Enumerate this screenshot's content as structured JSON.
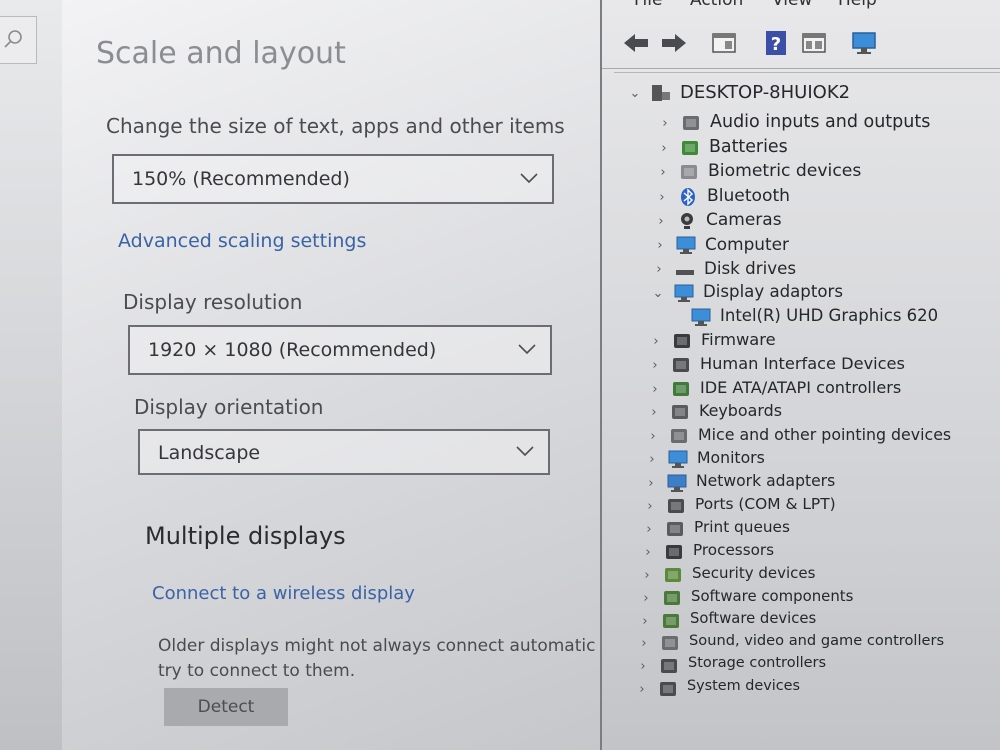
{
  "settings": {
    "title": "Scale and layout",
    "scale_label": "Change the size of text, apps and other items",
    "scale_value": "150% (Recommended)",
    "advanced_link": "Advanced scaling settings",
    "resolution_label": "Display resolution",
    "resolution_value": "1920 × 1080 (Recommended)",
    "orientation_label": "Display orientation",
    "orientation_value": "Landscape",
    "multiple_heading": "Multiple displays",
    "wireless_link": "Connect to a wireless display",
    "older_line1": "Older displays might not always connect automatic",
    "older_line2": "try to connect to them.",
    "detect_button": "Detect"
  },
  "device_manager": {
    "menu": [
      "File",
      "Action",
      "View",
      "Help"
    ],
    "toolbar_icons": [
      "back-arrow-icon",
      "forward-arrow-icon",
      "properties-icon",
      "help-icon",
      "view-icon",
      "monitor-icon"
    ],
    "root": "DESKTOP-8HUIOK2",
    "items": [
      {
        "label": "Audio inputs and outputs",
        "icon": "speaker-icon",
        "expanded": false
      },
      {
        "label": "Batteries",
        "icon": "battery-icon",
        "expanded": false
      },
      {
        "label": "Biometric devices",
        "icon": "fingerprint-icon",
        "expanded": false
      },
      {
        "label": "Bluetooth",
        "icon": "bluetooth-icon",
        "expanded": false
      },
      {
        "label": "Cameras",
        "icon": "camera-icon",
        "expanded": false
      },
      {
        "label": "Computer",
        "icon": "computer-icon",
        "expanded": false
      },
      {
        "label": "Disk drives",
        "icon": "disk-icon",
        "expanded": false
      },
      {
        "label": "Display adaptors",
        "icon": "display-adapter-icon",
        "expanded": true
      },
      {
        "label": "Intel(R) UHD Graphics 620",
        "icon": "display-adapter-icon",
        "child": true
      },
      {
        "label": "Firmware",
        "icon": "firmware-icon",
        "expanded": false
      },
      {
        "label": "Human Interface Devices",
        "icon": "hid-icon",
        "expanded": false
      },
      {
        "label": "IDE ATA/ATAPI controllers",
        "icon": "ide-icon",
        "expanded": false
      },
      {
        "label": "Keyboards",
        "icon": "keyboard-icon",
        "expanded": false
      },
      {
        "label": "Mice and other pointing devices",
        "icon": "mouse-icon",
        "expanded": false
      },
      {
        "label": "Monitors",
        "icon": "monitor-icon",
        "expanded": false
      },
      {
        "label": "Network adapters",
        "icon": "network-icon",
        "expanded": false
      },
      {
        "label": "Ports (COM & LPT)",
        "icon": "port-icon",
        "expanded": false
      },
      {
        "label": "Print queues",
        "icon": "printer-icon",
        "expanded": false
      },
      {
        "label": "Processors",
        "icon": "processor-icon",
        "expanded": false
      },
      {
        "label": "Security devices",
        "icon": "security-icon",
        "expanded": false
      },
      {
        "label": "Software components",
        "icon": "software-component-icon",
        "expanded": false
      },
      {
        "label": "Software devices",
        "icon": "software-device-icon",
        "expanded": false
      },
      {
        "label": "Sound, video and game controllers",
        "icon": "speaker-icon",
        "expanded": false
      },
      {
        "label": "Storage controllers",
        "icon": "storage-icon",
        "expanded": false
      },
      {
        "label": "System devices",
        "icon": "system-icon",
        "expanded": false
      }
    ]
  }
}
